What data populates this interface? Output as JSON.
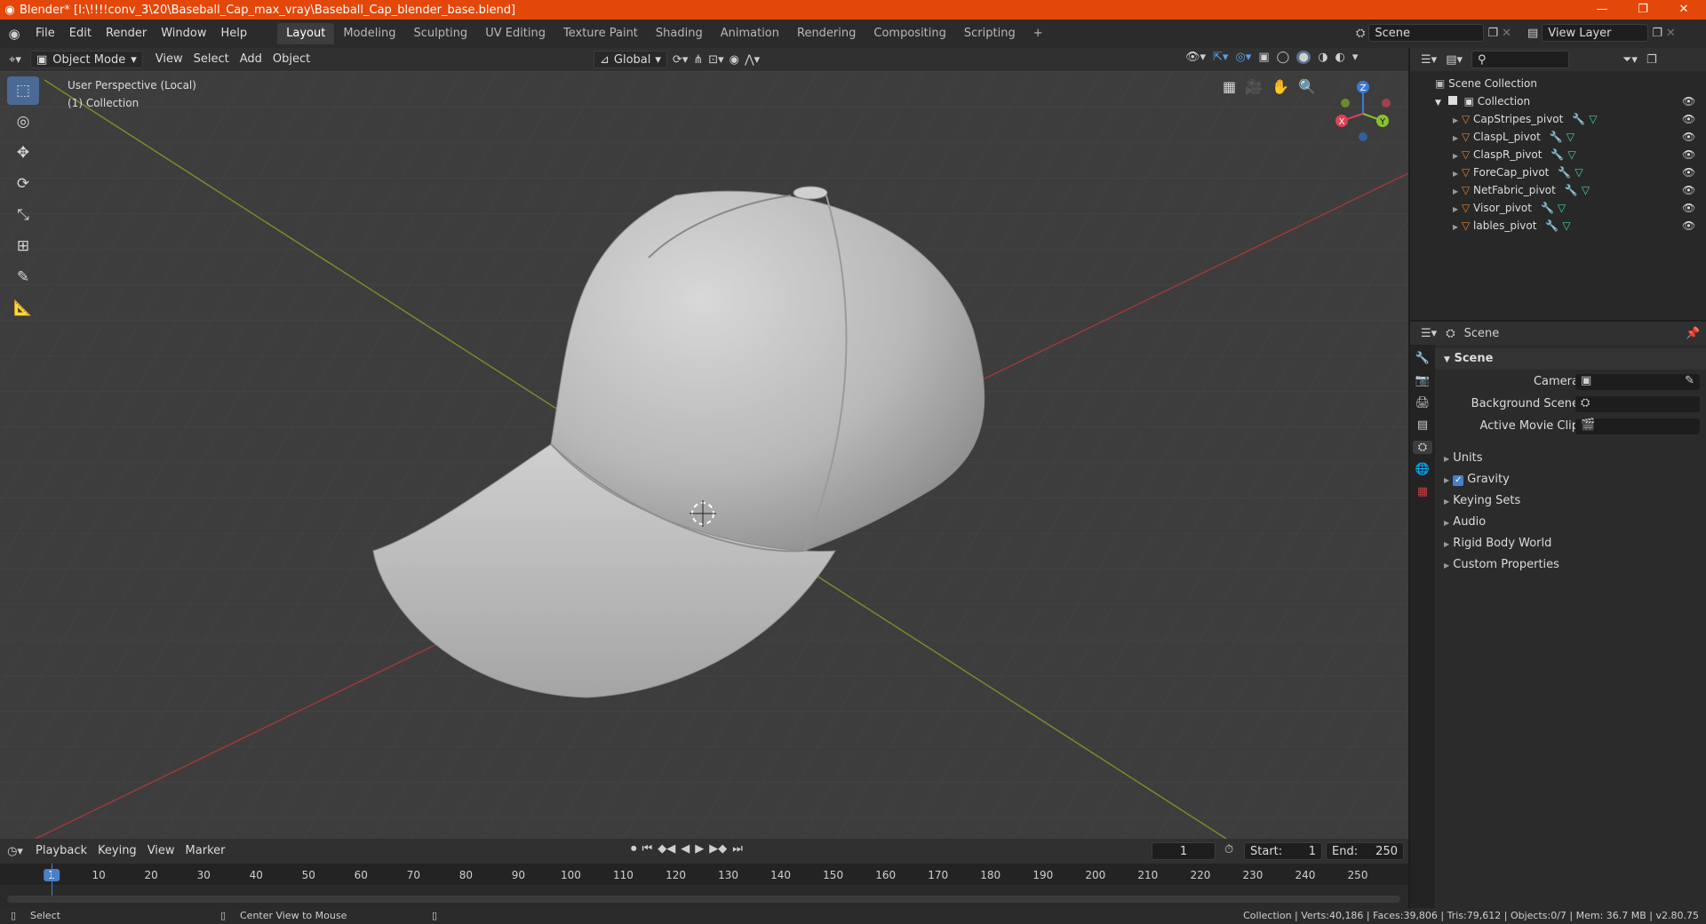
{
  "title": "Blender* [I:\\!!!!conv_3\\20\\Baseball_Cap_max_vray\\Baseball_Cap_blender_base.blend]",
  "window_controls": [
    "—",
    "❐",
    "✕"
  ],
  "menu": [
    "File",
    "Edit",
    "Render",
    "Window",
    "Help"
  ],
  "workspaces": [
    "Layout",
    "Modeling",
    "Sculpting",
    "UV Editing",
    "Texture Paint",
    "Shading",
    "Animation",
    "Rendering",
    "Compositing",
    "Scripting"
  ],
  "add_workspace": "+",
  "scene_name": "Scene",
  "view_layer": "View Layer",
  "viewport_header": {
    "mode": "Object Mode",
    "menus": [
      "View",
      "Select",
      "Add",
      "Object"
    ],
    "orientation": "Global"
  },
  "viewport_info": {
    "perspective": "User Perspective (Local)",
    "collection": "(1) Collection"
  },
  "gizmo": {
    "z": "Z",
    "y": "Y",
    "x": "X"
  },
  "outliner": {
    "root": "Scene Collection",
    "collection": "Collection",
    "items": [
      "CapStripes_pivot",
      "ClaspL_pivot",
      "ClaspR_pivot",
      "ForeCap_pivot",
      "NetFabric_pivot",
      "Visor_pivot",
      "lables_pivot"
    ]
  },
  "properties": {
    "header": "Scene",
    "panel": "Scene",
    "camera_label": "Camera",
    "background_label": "Background Scene",
    "movie_clip_label": "Active Movie Clip",
    "sections": [
      "Units",
      "Gravity",
      "Keying Sets",
      "Audio",
      "Rigid Body World",
      "Custom Properties"
    ]
  },
  "timeline": {
    "menus": [
      "Playback",
      "Keying",
      "View",
      "Marker"
    ],
    "current_frame": "1",
    "start_label": "Start:",
    "start": "1",
    "end_label": "End:",
    "end": "250",
    "ruler": [
      "1",
      "10",
      "20",
      "30",
      "40",
      "50",
      "60",
      "70",
      "80",
      "90",
      "100",
      "110",
      "120",
      "130",
      "140",
      "150",
      "160",
      "170",
      "180",
      "190",
      "200",
      "210",
      "220",
      "230",
      "240",
      "250"
    ]
  },
  "status": {
    "select": "Select",
    "center": "Center View to Mouse",
    "stats": "Collection | Verts:40,186 | Faces:39,806 | Tris:79,612 | Objects:0/7 | Mem: 36.7 MB | v2.80.75"
  },
  "colors": {
    "titlebar": "#e4470a",
    "accent": "#4a6a95",
    "mesh": "#e08030",
    "modifier": "#5aa0e0",
    "data": "#40d0b0"
  }
}
